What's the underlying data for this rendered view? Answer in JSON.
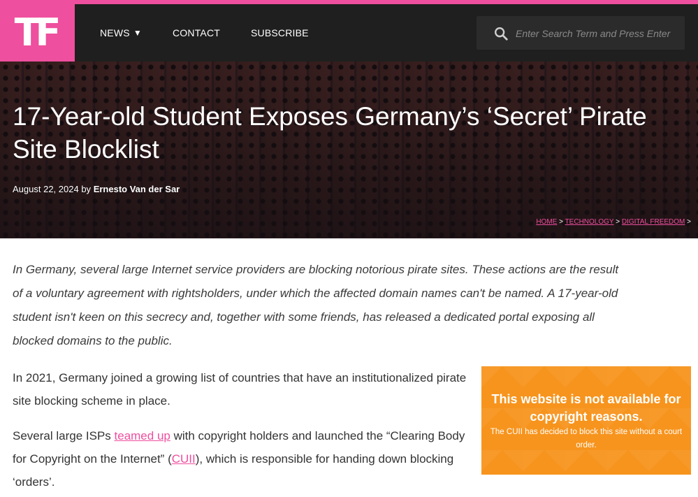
{
  "brand": {
    "logo_text": "TF",
    "accent_color": "#ee4f9e",
    "nav_bg_color": "#1f1f1f"
  },
  "nav": {
    "items": [
      {
        "label": "NEWS",
        "has_dropdown": true,
        "icon": "caret-down-icon"
      },
      {
        "label": "CONTACT"
      },
      {
        "label": "SUBSCRIBE"
      }
    ]
  },
  "search": {
    "placeholder": "Enter Search Term and Press Enter",
    "value": "",
    "icon": "search-icon"
  },
  "article": {
    "title": "17-Year-old Student Exposes Germany’s ‘Secret’ Pirate Site Blocklist",
    "date": "August 22, 2024",
    "by_label": "by",
    "author": "Ernesto Van der Sar",
    "breadcrumb": {
      "items": [
        "HOME",
        "TECHNOLOGY",
        "DIGITAL FREEDOM"
      ],
      "separator": ">"
    },
    "intro": "In Germany, several large Internet service providers are blocking notorious pirate sites. These actions are the result of a voluntary agreement with rightsholders, under which the affected domain names can't be named. A 17-year-old student isn't keen on this secrecy and, together with some friends, has released a dedicated portal exposing all blocked domains to the public.",
    "para1": "In 2021, Germany joined a growing list of countries that have an institutionalized pirate site blocking scheme in place.",
    "para2": {
      "text_before": "Several large ISPs ",
      "link1": "teamed up",
      "text_middle": " with copyright holders and launched the “Clearing Body for Copyright on the Internet” (",
      "link2": "CUII",
      "text_after": "), which is responsible for handing down blocking ‘orders’."
    }
  },
  "blocked_image": {
    "headline": "This website is not available for copyright reasons.",
    "subtext": "The CUII has decided to block this site without a court order.",
    "bg_color": "#f7941d"
  }
}
